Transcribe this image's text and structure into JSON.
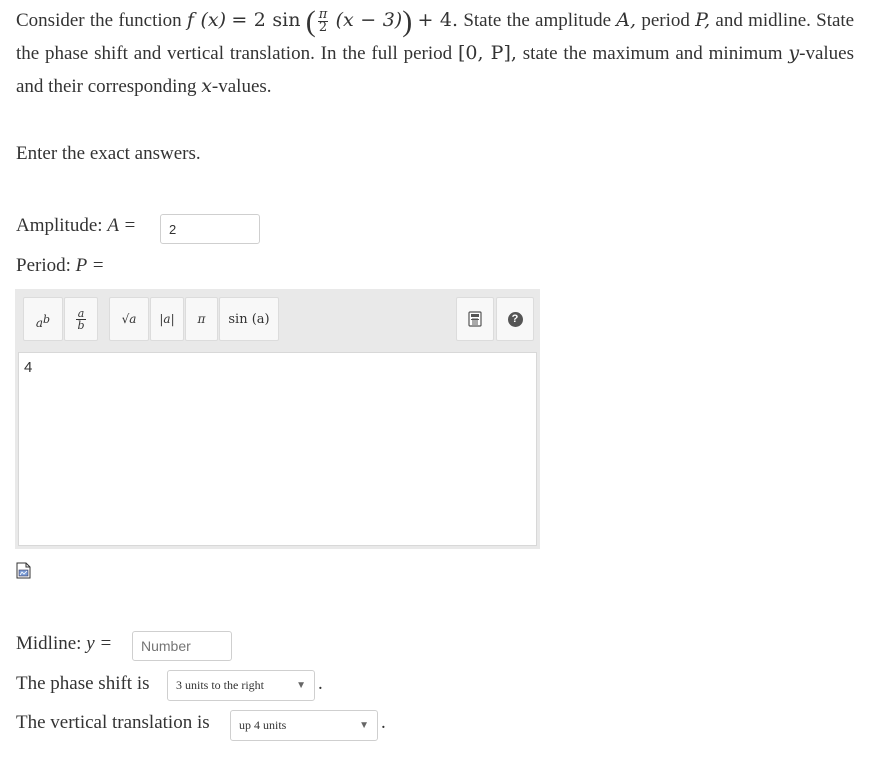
{
  "question": {
    "t1": "Consider the function",
    "fx": "f (x)",
    "eq": "= 2 sin",
    "pi": "π",
    "two": "2",
    "inner": "(x − 3)",
    "plus4": "+ 4.",
    "t2": "State the amplitude",
    "A": "A,",
    "t3": "period",
    "P": "P,",
    "t4": "and midline. State the phase shift and vertical translation. In the full period",
    "interval": "[0, P],",
    "t5": "state the maximum and minimum",
    "y": "y",
    "t6": "-values and their corresponding",
    "x": "x",
    "t7": "-values."
  },
  "instructions": "Enter the exact answers.",
  "amplitude": {
    "label": "Amplitude:",
    "var": "A =",
    "value": "2"
  },
  "period": {
    "label": "Period:",
    "var": "P ="
  },
  "toolbar": {
    "power_a": "a",
    "power_b": "b",
    "frac_a": "a",
    "frac_b": "b",
    "sqrt": "√a",
    "abs": "|a|",
    "pi": "π",
    "sin": "sin (a)",
    "help": "?"
  },
  "editor_value": "4",
  "midline": {
    "label": "Midline:",
    "var": "y =",
    "placeholder": "Number"
  },
  "phase_shift": {
    "label": "The phase shift is",
    "selected": "3 units to the right",
    "end": "."
  },
  "vertical": {
    "label": "The vertical translation is",
    "selected": "up 4 units",
    "end": "."
  }
}
